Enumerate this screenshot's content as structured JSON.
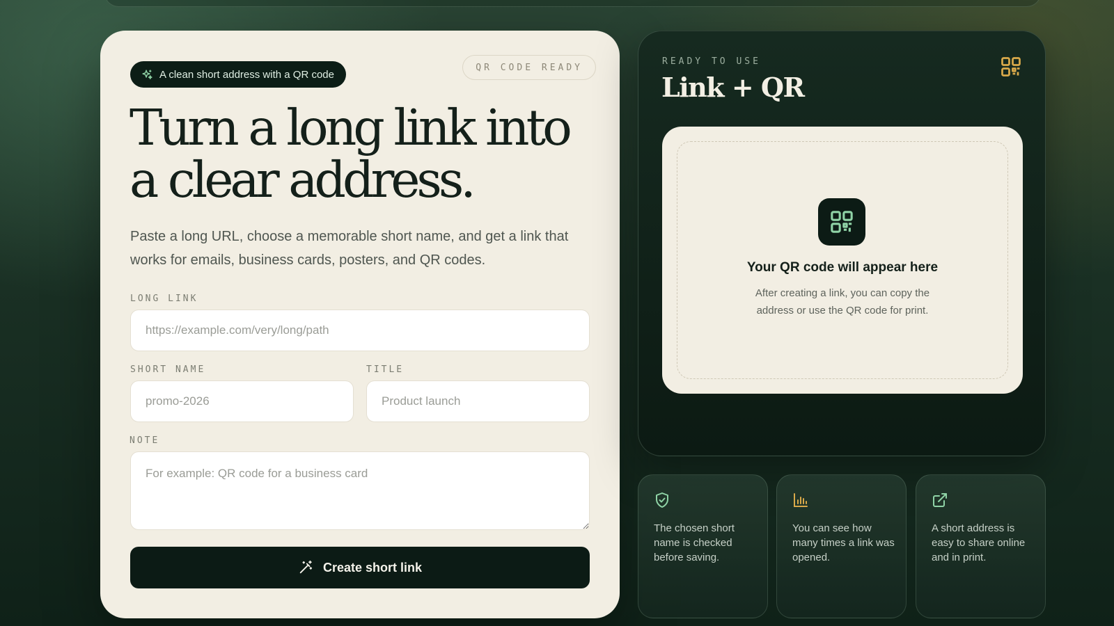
{
  "badge": {
    "label": "A clean short address with a QR code",
    "icon": "sparkles-icon"
  },
  "status": {
    "label": "QR CODE READY"
  },
  "hero": {
    "title": "Turn a long link into a clear address.",
    "subtitle": "Paste a long URL, choose a memorable short name, and get a link that works for emails, business cards, posters, and QR codes."
  },
  "form": {
    "long_link": {
      "label": "LONG LINK",
      "placeholder": "https://example.com/very/long/path",
      "value": ""
    },
    "short_name": {
      "label": "SHORT NAME",
      "placeholder": "promo-2026",
      "value": ""
    },
    "title": {
      "label": "TITLE",
      "placeholder": "Product launch",
      "value": ""
    },
    "note": {
      "label": "NOTE",
      "placeholder": "For example: QR code for a business card",
      "value": ""
    },
    "submit_label": "Create short link",
    "submit_icon": "magic-wand-icon"
  },
  "preview": {
    "eyebrow": "READY TO USE",
    "title": "Link + QR",
    "corner_icon": "qr-code-icon",
    "heading": "Your QR code will appear here",
    "text": "After creating a link, you can copy the address or use the QR code for print."
  },
  "features": [
    {
      "icon": "shield-check-icon",
      "text": "The chosen short name is checked before saving."
    },
    {
      "icon": "bar-chart-icon",
      "text": "You can see how many times a link was opened."
    },
    {
      "icon": "external-link-icon",
      "text": "A short address is easy to share online and in print."
    }
  ],
  "colors": {
    "accent_green": "#8fd3a6",
    "accent_gold": "#d9a94a",
    "card_cream": "#f2eee3",
    "ink": "#0c1b15"
  }
}
